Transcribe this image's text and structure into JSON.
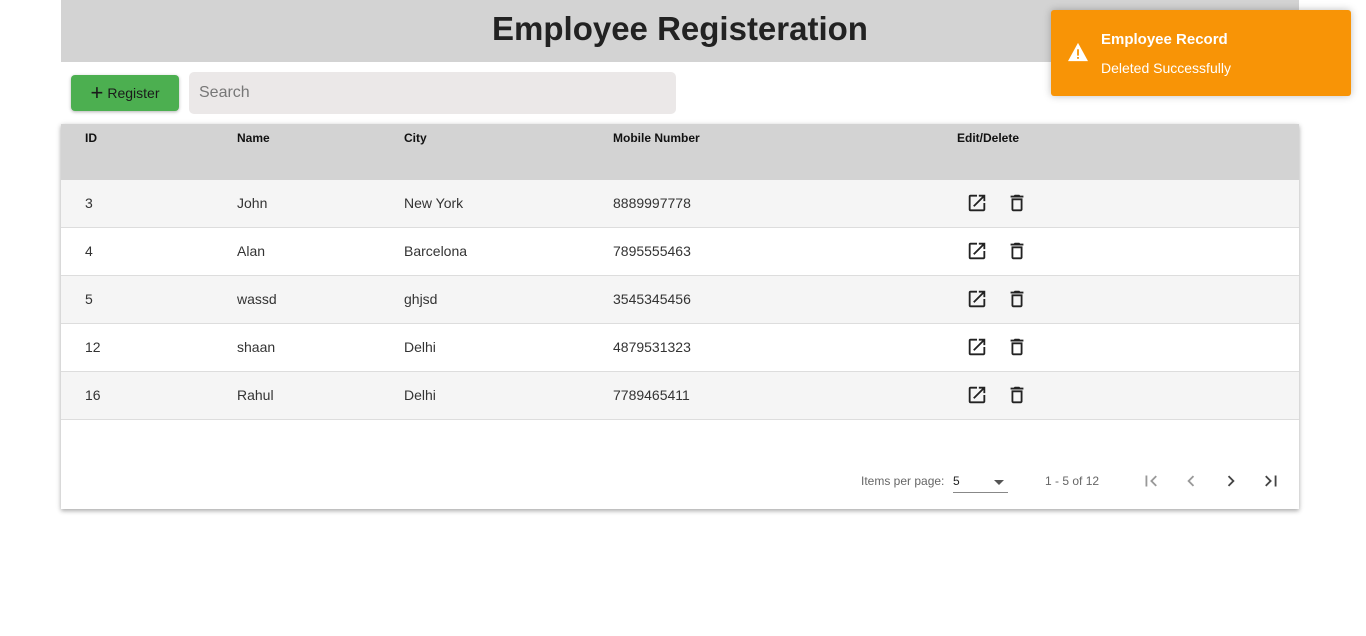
{
  "header": {
    "title": "Employee Registeration"
  },
  "toolbar": {
    "register_label": "Register",
    "search_placeholder": "Search",
    "search_value": ""
  },
  "table": {
    "columns": [
      "ID",
      "Name",
      "City",
      "Mobile Number",
      "Edit/Delete"
    ],
    "rows": [
      {
        "id": "3",
        "name": "John",
        "city": "New York",
        "mobile": "8889997778"
      },
      {
        "id": "4",
        "name": "Alan",
        "city": "Barcelona",
        "mobile": "7895555463"
      },
      {
        "id": "5",
        "name": "wassd",
        "city": "ghjsd",
        "mobile": "3545345456"
      },
      {
        "id": "12",
        "name": "shaan",
        "city": "Delhi",
        "mobile": "4879531323"
      },
      {
        "id": "16",
        "name": "Rahul",
        "city": "Delhi",
        "mobile": "7789465411"
      }
    ]
  },
  "paginator": {
    "items_per_page_label": "Items per page:",
    "page_size": "5",
    "range_label": "1 - 5 of 12"
  },
  "toast": {
    "title": "Employee Record",
    "message": "Deleted Successfully",
    "color": "#f89406"
  },
  "colors": {
    "header_bg": "#d3d3d3",
    "register_button": "#4caf50"
  },
  "icons": {
    "edit": "open-in-new-icon",
    "delete": "trash-icon"
  }
}
